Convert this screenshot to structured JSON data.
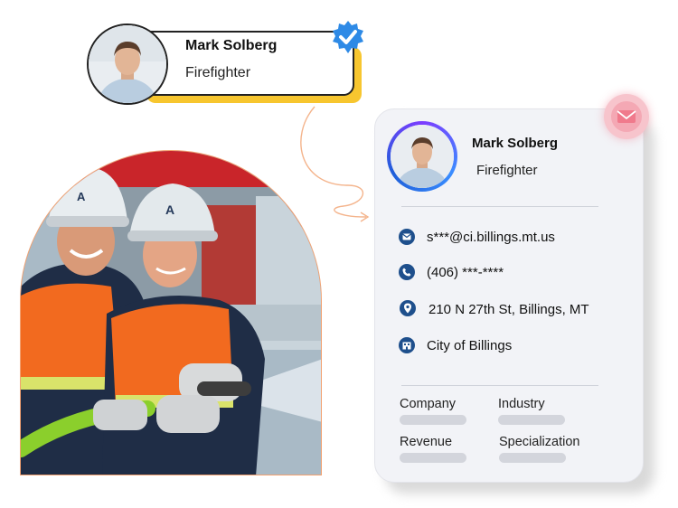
{
  "profile_chip": {
    "name": "Mark Solberg",
    "title": "Firefighter",
    "verified_icon": "verified-check-icon"
  },
  "contact_card": {
    "name": "Mark Solberg",
    "title": "Firefighter",
    "mail_icon": "envelope-icon",
    "details": [
      {
        "icon": "email-icon",
        "text": "s***@ci.billings.mt.us"
      },
      {
        "icon": "phone-icon",
        "text": "(406) ***-****"
      },
      {
        "icon": "location-pin-icon",
        "text": "210 N 27th St, Billings, MT"
      },
      {
        "icon": "building-icon",
        "text": "City of Billings"
      }
    ],
    "fields": [
      {
        "label": "Company"
      },
      {
        "label": "Industry"
      },
      {
        "label": "Revenue"
      },
      {
        "label": "Specialization"
      }
    ]
  },
  "colors": {
    "accent_yellow": "#f7c62f",
    "verified_blue": "#2e8ae6",
    "icon_navy": "#1e4f8c",
    "mail_pink": "#f4a8b4",
    "arch_border": "#f2a170"
  }
}
